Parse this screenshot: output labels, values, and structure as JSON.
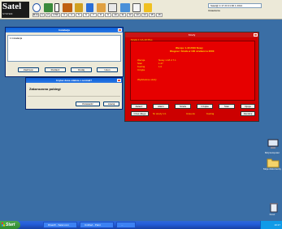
{
  "app": {
    "logo": "Satel",
    "logo_sub": "SYSTEM",
    "small_buttons": [
      "B:Ct",
      "1",
      "2",
      "2:Nb",
      "3",
      "4",
      "5",
      "6",
      "7",
      "8",
      "9",
      "10",
      "11",
      "12",
      "13",
      "14",
      "15",
      "16"
    ],
    "field_value": "Satel@ 1:17 23 21:00 1 2014",
    "field_value2": "Ustawienia"
  },
  "connection_window": {
    "title": "Instalacja",
    "list_item": "1 Instalacja",
    "buttons": [
      "Zadzwon",
      "Rozlacz",
      "Dodaj",
      "Usun"
    ]
  },
  "confirm_window": {
    "title": "Czytac dane zdalnie z centrali?",
    "message": "Zakonczono pobiegi",
    "buttons": [
      "Potwierdz",
      "Anuluj"
    ]
  },
  "zones_window": {
    "title": "Strefy",
    "header": "Strefa  1  CA-10 Plus",
    "line1": "Wersja: 1.18 2010 Nowy",
    "line2": "Dlugosc: Strefa w 100 strefami w 2000",
    "labels": [
      "Wersja",
      "Stan",
      "Kodzaj",
      "Czujka"
    ],
    "values": [
      "Nowy 1.18 2.7.1",
      "1.27",
      "1.0"
    ],
    "status": "Wydzielone strefy",
    "buttons_row1": [
      "Zalacz",
      "Alarm",
      "Strefa",
      "Czujka",
      "Stan",
      "Opcje"
    ],
    "buttons_row2": [
      "Czas dlugo",
      "Zamknij"
    ],
    "footer_texts": [
      "Nr strefy 1 b",
      "Czas do",
      "Kodzaj"
    ]
  },
  "desktop_icons": [
    {
      "label": "Mój komputer",
      "icon": "computer-icon"
    },
    {
      "label": "Moje dokumenty",
      "icon": "folder-icon"
    },
    {
      "label": "Kosz",
      "icon": "recycle-bin-icon"
    }
  ],
  "taskbar": {
    "start_label": "Start",
    "tasks": [
      "DloadX - Satel.com",
      "Untitled - Paint",
      "..."
    ],
    "tray_time": "10:17"
  }
}
